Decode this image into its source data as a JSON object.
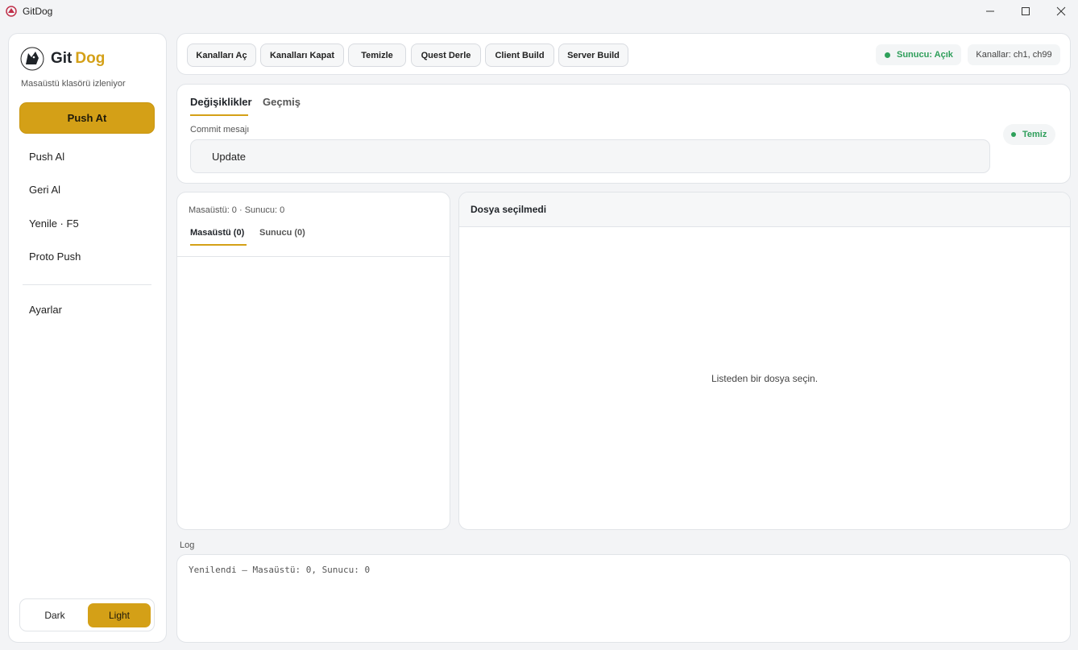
{
  "window": {
    "title": "GitDog",
    "controls": {
      "minimize": "—",
      "maximize": "☐",
      "close": "✕"
    }
  },
  "sidebar": {
    "logo_git": "Git",
    "logo_dog": "Dog",
    "status": "Masaüstü klasörü izleniyor",
    "primary_action": "Push At",
    "items": [
      "Push Al",
      "Geri Al",
      "Yenile · F5",
      "Proto Push"
    ],
    "settings": "Ayarlar",
    "theme": {
      "dark": "Dark",
      "light": "Light",
      "selected": "Light"
    }
  },
  "toolbar": {
    "buttons": [
      "Kanalları Aç",
      "Kanalları Kapat",
      "Temizle",
      "Quest Derle",
      "Client Build",
      "Server Build"
    ],
    "server_status": "Sunucu: Açık",
    "channels": "Kanallar: ch1, ch99"
  },
  "commit": {
    "tabs": [
      "Değişiklikler",
      "Geçmiş"
    ],
    "active_tab": "Değişiklikler",
    "message_label": "Commit mesajı",
    "message_value": "Update",
    "state_badge": "Temiz"
  },
  "files": {
    "counts": "Masaüstü: 0  ·  Sunucu: 0",
    "tabs": [
      "Masaüstü (0)",
      "Sunucu (0)"
    ]
  },
  "preview": {
    "header": "Dosya seçilmedi",
    "empty_text": "Listeden bir dosya seçin."
  },
  "log": {
    "label": "Log",
    "lines": [
      "Yenilendi — Masaüstü: 0, Sunucu: 0"
    ]
  },
  "colors": {
    "accent": "#d4a017",
    "success": "#2e9e5a"
  }
}
